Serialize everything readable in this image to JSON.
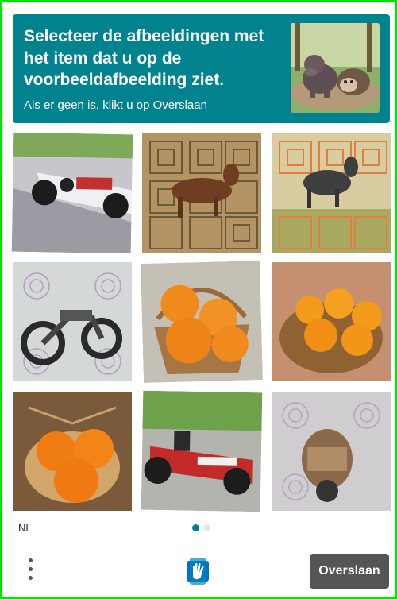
{
  "challenge": {
    "prompt": "Selecteer de afbeeldingen met het item dat u op de voorbeeldafbeelding ziet.",
    "subtext": "Als er geen is, klikt u op Overslaan",
    "example_image": "hippo-and-hedgehog"
  },
  "grid": {
    "tiles": [
      {
        "content": "formula-one-car"
      },
      {
        "content": "running-horse-patterned"
      },
      {
        "content": "running-horse-patterned"
      },
      {
        "content": "motorcycle-patterned"
      },
      {
        "content": "oranges-in-basket"
      },
      {
        "content": "oranges-in-basket"
      },
      {
        "content": "oranges-in-basket"
      },
      {
        "content": "formula-one-car"
      },
      {
        "content": "motorcycle-patterned"
      }
    ]
  },
  "footer": {
    "language": "NL",
    "page_indicator": {
      "current": 1,
      "total": 2
    },
    "skip_label": "Overslaan",
    "menu_icon": "more-vertical-icon",
    "logo_icon": "hcaptcha-hand-icon"
  },
  "colors": {
    "header_bg": "#00838f",
    "border": "#00e600",
    "skip_bg": "#555555",
    "dot_active": "#00838f",
    "dot_inactive": "#e6e6e6"
  }
}
